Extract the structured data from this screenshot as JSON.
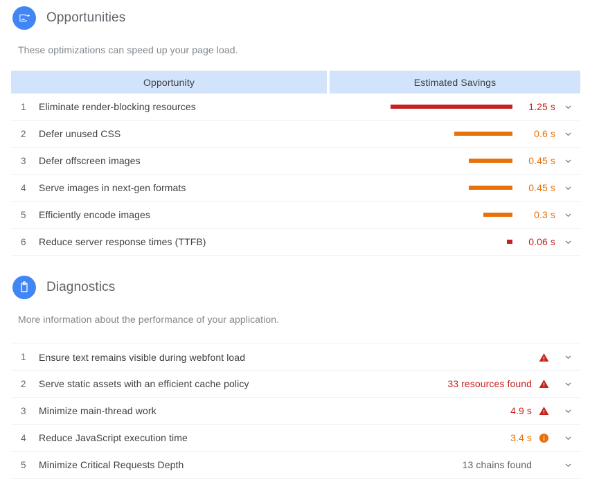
{
  "opportunities": {
    "icon": "add-photo-icon",
    "title": "Opportunities",
    "description": "These optimizations can speed up your page load.",
    "columns": {
      "opportunity": "Opportunity",
      "savings": "Estimated Savings"
    },
    "colors": {
      "red": "#c5221f",
      "orange": "#e8710a",
      "header_bg": "#d2e3fc",
      "accent": "#4285f4"
    },
    "rows": [
      {
        "num": "1",
        "label": "Eliminate render-blocking resources",
        "value": "1.25 s",
        "seconds": 1.25,
        "severity": "red",
        "chevron": "chevron-down-icon"
      },
      {
        "num": "2",
        "label": "Defer unused CSS",
        "value": "0.6 s",
        "seconds": 0.6,
        "severity": "orange",
        "chevron": "chevron-down-icon"
      },
      {
        "num": "3",
        "label": "Defer offscreen images",
        "value": "0.45 s",
        "seconds": 0.45,
        "severity": "orange",
        "chevron": "chevron-down-icon"
      },
      {
        "num": "4",
        "label": "Serve images in next-gen formats",
        "value": "0.45 s",
        "seconds": 0.45,
        "severity": "orange",
        "chevron": "chevron-down-icon"
      },
      {
        "num": "5",
        "label": "Efficiently encode images",
        "value": "0.3 s",
        "seconds": 0.3,
        "severity": "orange",
        "chevron": "chevron-down-icon"
      },
      {
        "num": "6",
        "label": "Reduce server response times (TTFB)",
        "value": "0.06 s",
        "seconds": 0.06,
        "severity": "red",
        "chevron": "chevron-down-icon"
      }
    ]
  },
  "diagnostics": {
    "icon": "clipboard-icon",
    "title": "Diagnostics",
    "description": "More information about the performance of your application.",
    "rows": [
      {
        "num": "1",
        "label": "Ensure text remains visible during webfont load",
        "value": "",
        "status": "warning-triangle-icon",
        "severity": "red",
        "chevron": "chevron-down-icon"
      },
      {
        "num": "2",
        "label": "Serve static assets with an efficient cache policy",
        "value": "33 resources found",
        "status": "warning-triangle-icon",
        "severity": "red",
        "chevron": "chevron-down-icon"
      },
      {
        "num": "3",
        "label": "Minimize main-thread work",
        "value": "4.9 s",
        "status": "warning-triangle-icon",
        "severity": "red",
        "chevron": "chevron-down-icon"
      },
      {
        "num": "4",
        "label": "Reduce JavaScript execution time",
        "value": "3.4 s",
        "status": "info-circle-icon",
        "severity": "orange",
        "chevron": "chevron-down-icon"
      },
      {
        "num": "5",
        "label": "Minimize Critical Requests Depth",
        "value": "13 chains found",
        "status": "",
        "severity": "gray",
        "chevron": "chevron-down-icon"
      }
    ]
  }
}
